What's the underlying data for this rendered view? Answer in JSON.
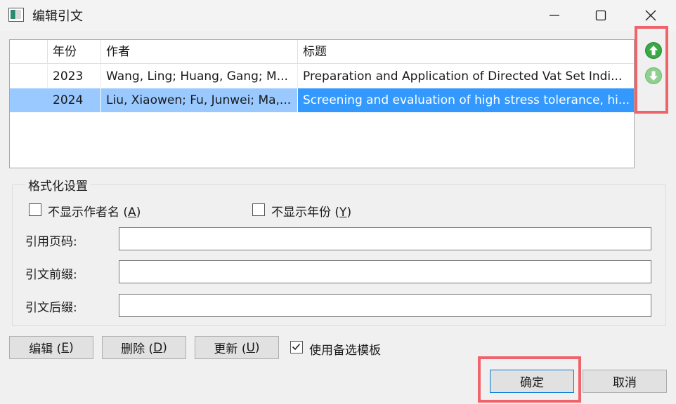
{
  "window": {
    "title": "编辑引文",
    "icons": {
      "minimize": "minimize-icon",
      "maximize": "maximize-icon",
      "close": "close-icon"
    }
  },
  "table": {
    "columns": [
      "",
      "年份",
      "作者",
      "标题"
    ],
    "rows": [
      {
        "year": "2023",
        "authors": "Wang, Ling; Huang, Gang; M...",
        "title": "Preparation and Application of Directed Vat Set Indi...",
        "selected": false
      },
      {
        "year": "2024",
        "authors": "Liu, Xiaowen; Fu, Junwei; Ma,...",
        "title": "Screening and evaluation of high stress tolerance, hi...",
        "selected": true
      }
    ]
  },
  "side_icons": {
    "up": "arrow-up-circle-icon",
    "down": "arrow-down-circle-icon"
  },
  "format": {
    "group_title": "格式化设置",
    "hide_author": {
      "label": "不显示作者名 (",
      "key": "A",
      "suffix": ")",
      "checked": false
    },
    "hide_year": {
      "label": "不显示年份 (",
      "key": "Y",
      "suffix": ")",
      "checked": false
    },
    "page_label": "引用页码:",
    "page_value": "",
    "prefix_label": "引文前缀:",
    "prefix_value": "",
    "suffix_label": "引文后缀:",
    "suffix_value": ""
  },
  "buttons": {
    "edit": {
      "label": "编辑 (",
      "key": "E",
      "suffix": ")"
    },
    "delete": {
      "label": "删除 (",
      "key": "D",
      "suffix": ")"
    },
    "update": {
      "label": "更新 (",
      "key": "U",
      "suffix": ")"
    },
    "alt_template": {
      "label": "使用备选模板",
      "checked": true
    },
    "ok": "确定",
    "cancel": "取消"
  },
  "colors": {
    "selection_row": "#99c9ff",
    "selection_cell": "#3399ff",
    "highlight_box": "#f0636b",
    "arrow_green": "#3aa845"
  }
}
